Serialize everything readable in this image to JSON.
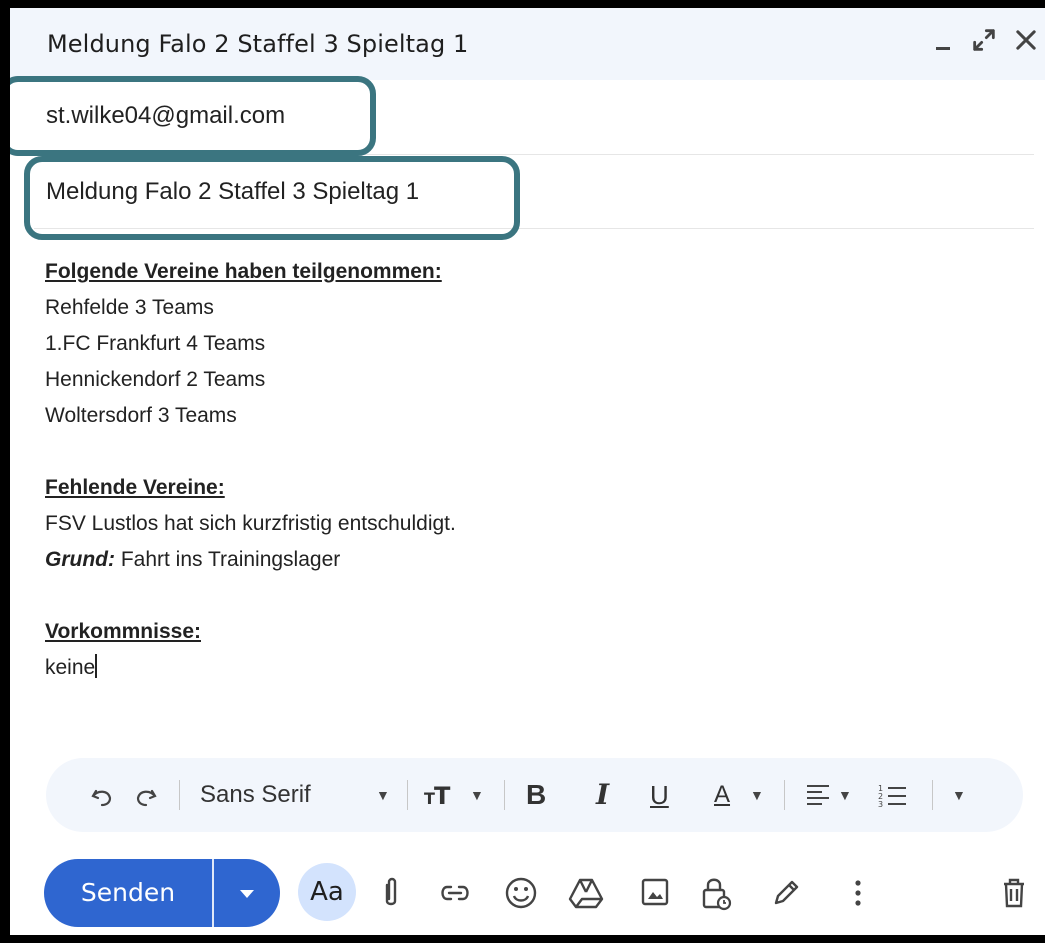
{
  "window": {
    "title": "Meldung Falo 2 Staffel 3 Spieltag 1",
    "controls": [
      "minimize-icon",
      "expand-icon",
      "close-icon"
    ]
  },
  "compose": {
    "to": "st.wilke04@gmail.com",
    "subject": "Meldung Falo 2 Staffel 3 Spieltag 1",
    "body": {
      "participants_heading": "Folgende Vereine haben teilgenommen:",
      "participants": [
        "Rehfelde 3 Teams",
        "1.FC Frankfurt 4 Teams",
        "Hennickendorf 2 Teams",
        "Woltersdorf 3 Teams"
      ],
      "missing_heading": "Fehlende Vereine:",
      "missing_text": "FSV Lustlos hat sich kurzfristig entschuldigt.",
      "reason_label": "Grund:",
      "reason_text": " Fahrt ins Trainingslager",
      "incidents_heading": "Vorkommnisse:",
      "incidents_text": "keine"
    }
  },
  "formatting": {
    "font": "Sans Serif",
    "bold": "B",
    "italic": "I",
    "underline": "U",
    "text_color": "A",
    "icons": [
      "undo-icon",
      "redo-icon",
      "text-size-icon",
      "align-icon",
      "numbered-list-icon",
      "more-formatting-icon"
    ]
  },
  "bottom": {
    "send_label": "Senden",
    "formatting_toggle": "Aa",
    "icons": [
      "attach-icon",
      "link-icon",
      "emoji-icon",
      "drive-icon",
      "photo-icon",
      "confidential-icon",
      "signature-icon",
      "more-options-icon",
      "trash-icon"
    ]
  },
  "colors": {
    "send_button": "#2f66d0",
    "highlight_border": "#3b7580",
    "titlebar": "#f2f6fc",
    "formatting_toggle": "#d3e3fd"
  }
}
